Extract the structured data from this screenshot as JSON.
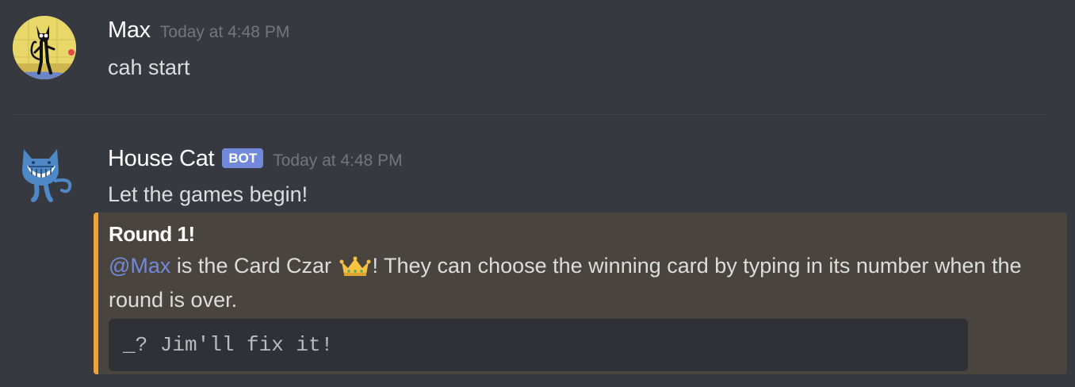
{
  "messages": [
    {
      "username": "Max",
      "timestamp": "Today at 4:48 PM",
      "text": "cah start",
      "avatar_icon": "cat-cartoon-avatar-icon"
    },
    {
      "username": "House Cat",
      "bot_badge": "BOT",
      "timestamp": "Today at 4:48 PM",
      "text": "Let the games begin!",
      "avatar_icon": "grinning-cat-avatar-icon",
      "embed": {
        "accent_color": "#f0a33a",
        "title": "Round 1!",
        "mention": "@Max",
        "desc_part1": " is the Card Czar ",
        "crown_icon": "crown-emoji-icon",
        "desc_part2": "! They can choose the winning card by typing in its number when the round is over.",
        "code": "_? Jim'll fix it!"
      }
    }
  ],
  "colors": {
    "background": "#36393f",
    "mention": "#7289da",
    "bot_badge": "#7289da",
    "embed_background": "#4a443e",
    "codeblock_background": "#2f3136"
  }
}
